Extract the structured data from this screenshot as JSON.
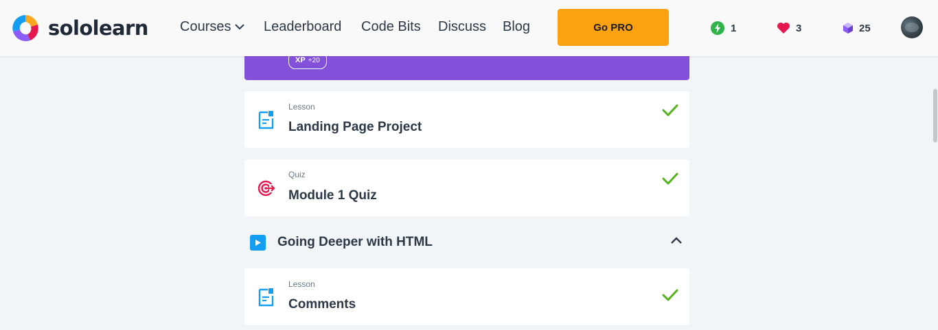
{
  "header": {
    "logo_text": "sololearn",
    "nav": [
      {
        "label": "Courses"
      },
      {
        "label": "Leaderboard"
      },
      {
        "label": "Code Bits"
      },
      {
        "label": "Discuss"
      },
      {
        "label": "Blog"
      }
    ],
    "go_pro_label": "Go PRO",
    "stats": {
      "streak": "1",
      "hearts": "3",
      "bits": "25"
    },
    "colors": {
      "go_pro": "#fca211",
      "streak": "#2fb34a",
      "heart": "#e6174e",
      "bits": "#8b5cf6"
    }
  },
  "banner": {
    "xp_label": "XP",
    "xp_amount": "+20",
    "color": "#8350da"
  },
  "items": [
    {
      "type": "Lesson",
      "title": "Landing Page Project",
      "icon": "lesson-icon",
      "completed": true
    },
    {
      "type": "Quiz",
      "title": "Module 1 Quiz",
      "icon": "quiz-target-icon",
      "completed": true
    }
  ],
  "section": {
    "title": "Going Deeper with HTML",
    "expanded": true,
    "items": [
      {
        "type": "Lesson",
        "title": "Comments",
        "icon": "lesson-icon",
        "completed": true
      }
    ]
  }
}
